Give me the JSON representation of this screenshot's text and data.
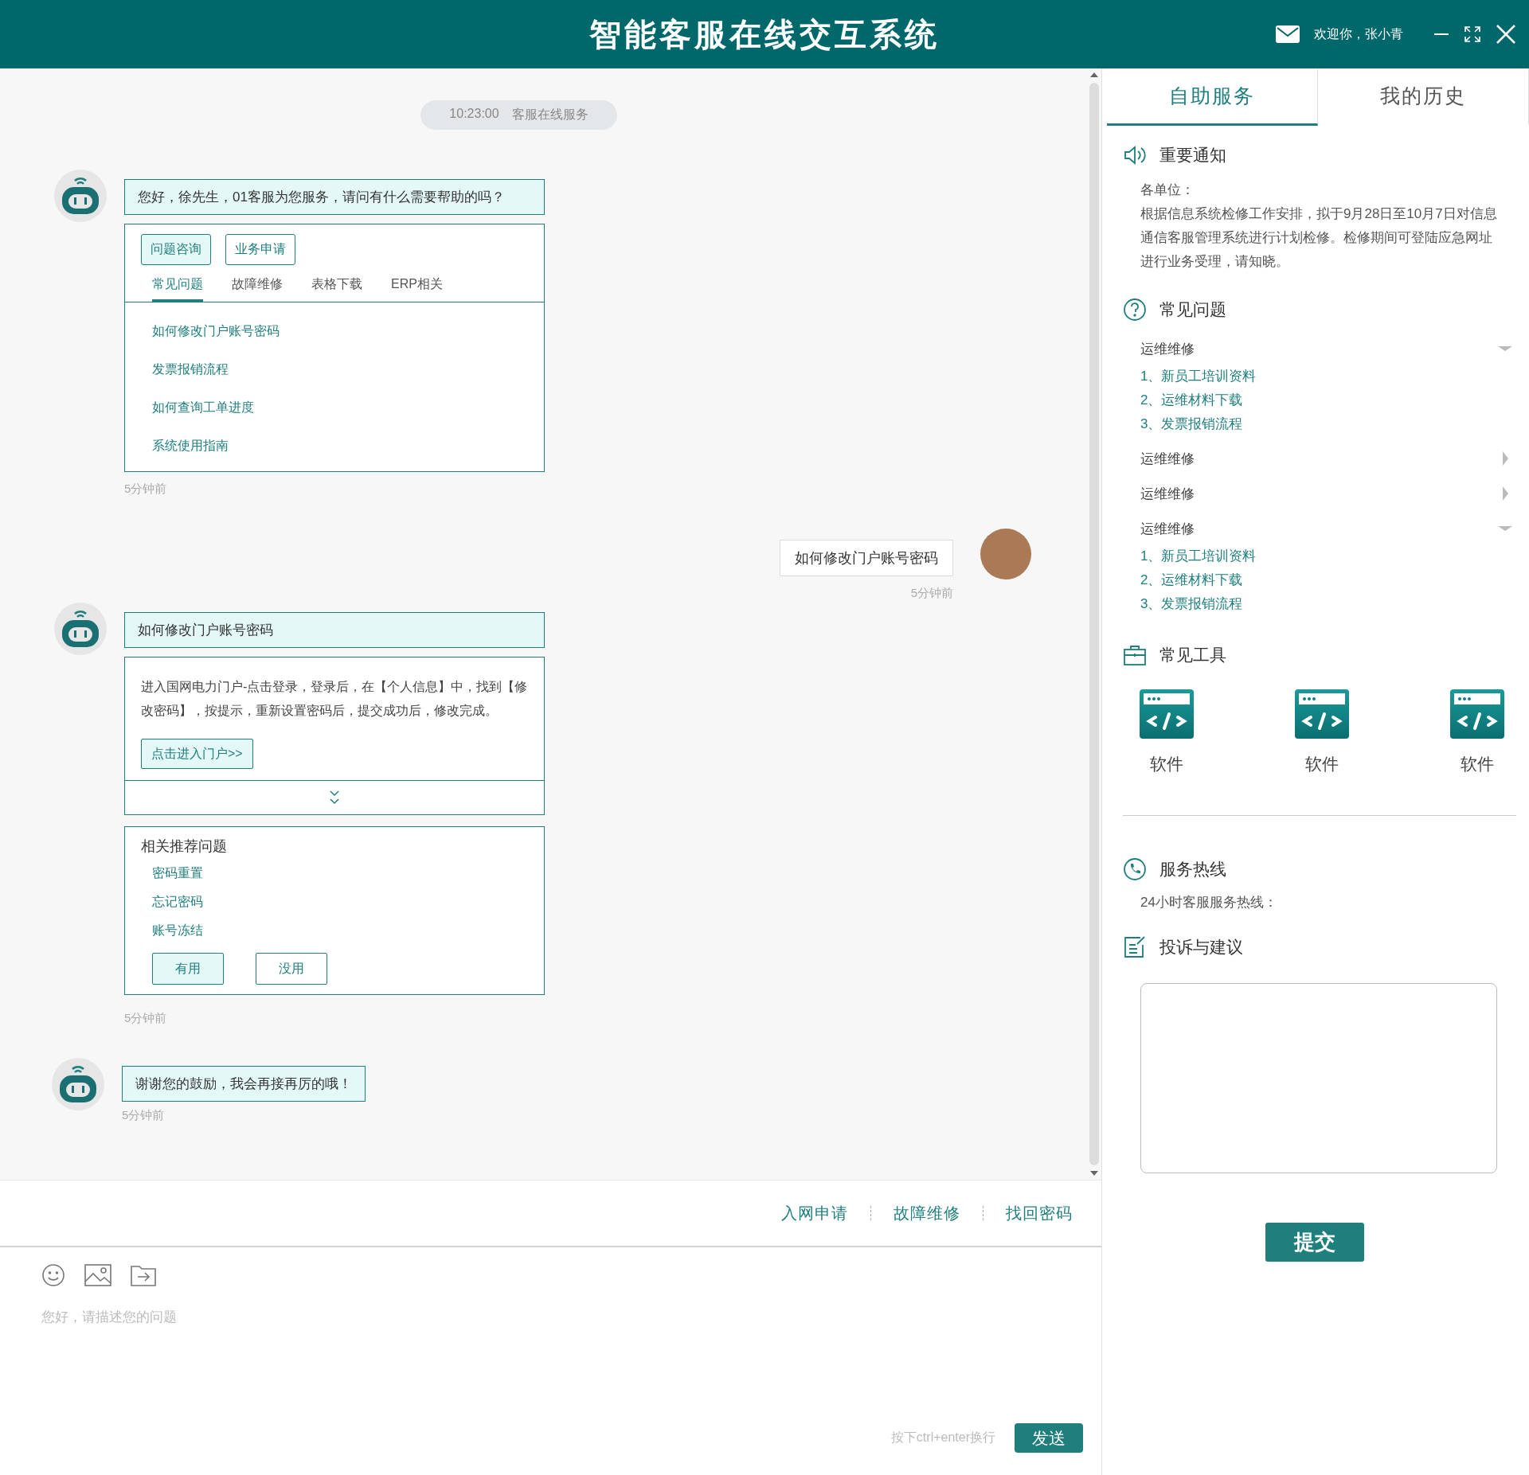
{
  "header": {
    "title": "智能客服在线交互系统",
    "welcome": "欢迎你，张小青"
  },
  "chat": {
    "stamp": {
      "time": "10:23:00",
      "label": "客服在线服务"
    },
    "messages": [
      {
        "kind": "bot_menu",
        "text": "您好，徐先生，01客服为您服务，请问有什么需要帮助的吗？",
        "buttons": [
          {
            "label": "问题咨询",
            "selected": true
          },
          {
            "label": "业务申请",
            "selected": false
          }
        ],
        "tabs": [
          {
            "label": "常见问题",
            "selected": true
          },
          {
            "label": "故障维修",
            "selected": false
          },
          {
            "label": "表格下载",
            "selected": false
          },
          {
            "label": "ERP相关",
            "selected": false
          }
        ],
        "items": [
          "如何修改门户账号密码",
          "发票报销流程",
          "如何查询工单进度",
          "系统使用指南"
        ],
        "time": "5分钟前"
      },
      {
        "kind": "user",
        "text": "如何修改门户账号密码",
        "time": "5分钟前"
      },
      {
        "kind": "bot_answer",
        "text": "如何修改门户账号密码",
        "answer": "进入国网电力门户-点击登录，登录后，在【个人信息】中，找到【修改密码】，按提示，重新设置密码后，提交成功后，修改完成。",
        "link": "点击进入门户>>",
        "related_title": "相关推荐问题",
        "related": [
          "密码重置",
          "忘记密码",
          "账号冻结"
        ],
        "feedback": [
          {
            "label": "有用",
            "selected": true
          },
          {
            "label": "没用",
            "selected": false
          }
        ],
        "time": "5分钟前"
      },
      {
        "kind": "bot_text",
        "text": "谢谢您的鼓励，我会再接再厉的哦！",
        "time": "5分钟前"
      }
    ]
  },
  "quick_links": [
    "入网申请",
    "故障维修",
    "找回密码"
  ],
  "input": {
    "placeholder": "您好，请描述您的问题",
    "hint": "按下ctrl+enter换行",
    "send": "发送"
  },
  "side": {
    "tabs": [
      {
        "label": "自助服务",
        "selected": true
      },
      {
        "label": "我的历史",
        "selected": false
      }
    ],
    "notice": {
      "title": "重要通知",
      "greeting": "各单位：",
      "body": "根据信息系统检修工作安排，拟于9月28日至10月7日对信息通信客服管理系统进行计划检修。检修期间可登陆应急网址进行业务受理，请知晓。"
    },
    "faq": {
      "title": "常见问题",
      "groups": [
        {
          "label": "运维维修",
          "expanded": true,
          "children": [
            "1、新员工培训资料",
            "2、运维材料下载",
            "3、发票报销流程"
          ]
        },
        {
          "label": "运维维修",
          "expanded": false
        },
        {
          "label": "运维维修",
          "expanded": false
        },
        {
          "label": "运维维修",
          "expanded": true,
          "children": [
            "1、新员工培训资料",
            "2、运维材料下载",
            "3、发票报销流程"
          ]
        }
      ]
    },
    "tools": {
      "title": "常见工具",
      "items": [
        "软件",
        "软件",
        "软件"
      ]
    },
    "hotline": {
      "title": "服务热线",
      "text": "24小时客服服务热线："
    },
    "feedback": {
      "title": "投诉与建议",
      "submit": "提交"
    }
  }
}
